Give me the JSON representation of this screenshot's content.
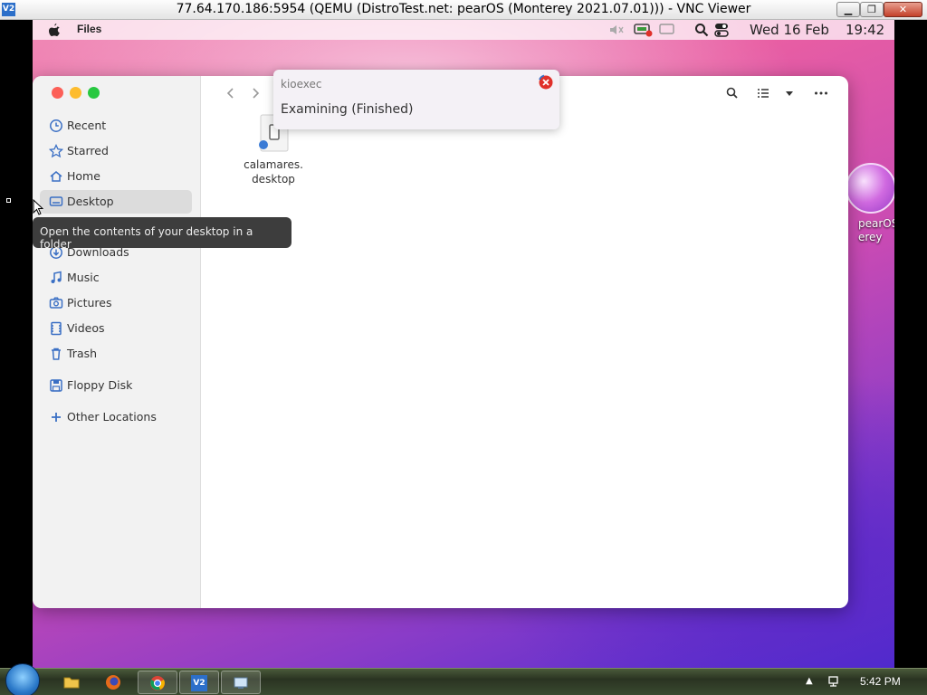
{
  "vnc": {
    "logo": "V2",
    "title": "77.64.170.186:5954 (QEMU (DistroTest.net: pearOS (Monterey 2021.07.01))) - VNC Viewer",
    "minimize": "▁",
    "maximize": "❐",
    "close": "✕"
  },
  "topbar": {
    "app_name": "Files",
    "date": "Wed 16 Feb",
    "time": "19:42",
    "icons": [
      "apple-icon",
      "volume-muted-icon",
      "network-icon",
      "display-icon",
      "search-icon",
      "toggle-icon"
    ]
  },
  "desktop_icon": {
    "label": "pearOS Monterey",
    "label_line1": "pearOS",
    "label_line2": "erey"
  },
  "sidebar": {
    "items": [
      {
        "label": "Recent",
        "icon": "clock-icon"
      },
      {
        "label": "Starred",
        "icon": "star-icon"
      },
      {
        "label": "Home",
        "icon": "home-icon"
      },
      {
        "label": "Desktop",
        "icon": "desktop-icon",
        "active": true
      },
      {
        "label": "Downloads",
        "icon": "download-icon"
      },
      {
        "label": "Music",
        "icon": "music-icon"
      },
      {
        "label": "Pictures",
        "icon": "camera-icon"
      },
      {
        "label": "Videos",
        "icon": "film-icon"
      },
      {
        "label": "Trash",
        "icon": "trash-icon"
      },
      {
        "label": "Floppy Disk",
        "icon": "floppy-icon"
      },
      {
        "label": "Other Locations",
        "icon": "plus-icon"
      }
    ]
  },
  "file": {
    "name_line1": "calamares.",
    "name_line2": "desktop"
  },
  "kioexec": {
    "title": "kioexec",
    "status": "Examining (Finished)"
  },
  "tooltip": {
    "text": "Open the contents of your desktop in a folder"
  },
  "taskbar": {
    "time": "5:42 PM",
    "vnc_label": "V2"
  },
  "colors": {
    "accent_close": "#fc5f57",
    "accent_min": "#fdbc2e",
    "accent_max": "#28c840"
  }
}
